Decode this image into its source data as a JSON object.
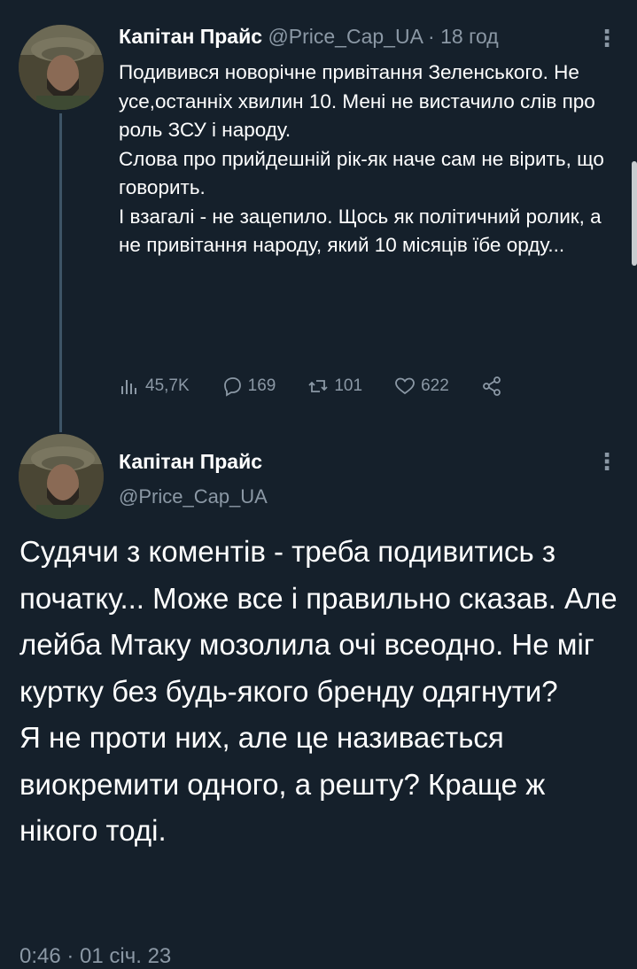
{
  "tweet1": {
    "display_name": "Капітан Прайс",
    "handle": "@Price_Cap_UA",
    "separator": "·",
    "time": "18 год",
    "paragraphs": [
      "Подивився новорічне привітання Зеленського. Не усе,останніх хвилин 10. Мені не вистачило слів про роль ЗСУ і народу.",
      "Слова про прийдешній рік-як наче сам не вірить, що говорить.",
      "І взагалі - не зацепило. Щось як політичний ролик, а не привітання народу, який 10 місяців їбе орду..."
    ],
    "stats": {
      "views": "45,7K",
      "replies": "169",
      "retweets": "101",
      "likes": "622"
    }
  },
  "tweet2": {
    "display_name": "Капітан Прайс",
    "handle": "@Price_Cap_UA",
    "paragraphs": [
      "Судячи з коментів - треба подивитись з початку... Може все і правильно сказав. Але лейба Мтаку мозолила очі всеодно. Не міг куртку без будь-якого бренду одягнути?",
      "Я не проти них, але це називається виокремити одного, а решту? Краще ж нікого тоді."
    ],
    "timestamp": "0:46 · 01 січ. 23"
  },
  "icons": {
    "more": "more-vertical-icon",
    "views": "analytics-icon",
    "reply": "reply-icon",
    "retweet": "retweet-icon",
    "like": "heart-icon",
    "share": "share-icon"
  },
  "colors": {
    "background": "#15202b",
    "text": "#ffffff",
    "muted": "#8b98a5",
    "thread_line": "#3d5466"
  }
}
